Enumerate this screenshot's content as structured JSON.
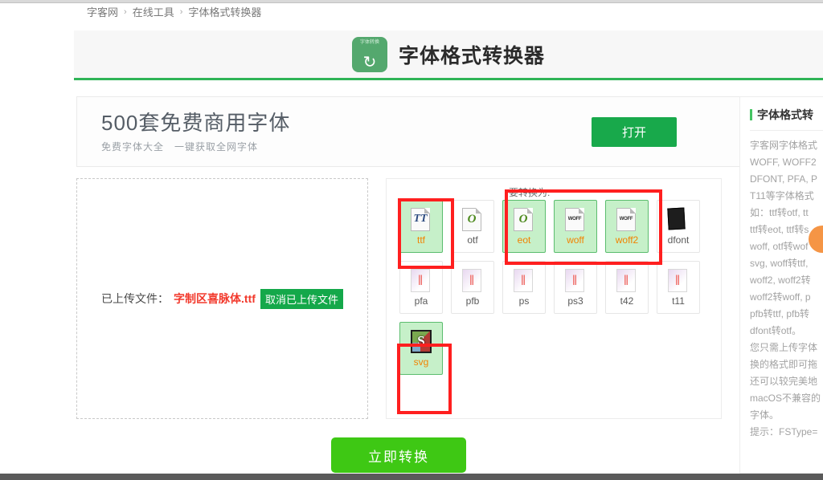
{
  "breadcrumb": {
    "items": [
      "字客网",
      "在线工具",
      "字体格式转换器"
    ],
    "separator": "›"
  },
  "header": {
    "logo_mini_text": "字体转换",
    "logo_glyph": "↻",
    "title": "字体格式转换器"
  },
  "ad_banner": {
    "title": "500套免费商用字体",
    "subtitle": "免费字体大全　一键获取全网字体",
    "button_label": "打开",
    "button_color": "#18a94b"
  },
  "upload": {
    "label": "已上传文件：",
    "filename": "字制区喜脉体.ttf",
    "filename_color": "#f2392c",
    "cancel_label": "取消已上传文件",
    "cancel_color": "#14a84a"
  },
  "formats": {
    "convert_to_label": "要转换为:",
    "selected_bg": "#c6f0c9",
    "selected_border": "#5bbd6e",
    "selected_label_color": "#f28200",
    "items": [
      {
        "name": "ttf",
        "icon": "truetype-file-icon",
        "selected": true
      },
      {
        "name": "otf",
        "icon": "opentype-file-icon",
        "selected": false
      },
      {
        "name": "eot",
        "icon": "opentype-file-icon",
        "selected": true
      },
      {
        "name": "woff",
        "icon": "woff-file-icon",
        "selected": true
      },
      {
        "name": "woff2",
        "icon": "woff-file-icon",
        "selected": true
      },
      {
        "name": "dfont",
        "icon": "dfont-file-icon",
        "selected": false
      },
      {
        "name": "pfa",
        "icon": "postscript-file-icon",
        "selected": false
      },
      {
        "name": "pfb",
        "icon": "postscript-file-icon",
        "selected": false
      },
      {
        "name": "ps",
        "icon": "postscript-file-icon",
        "selected": false
      },
      {
        "name": "ps3",
        "icon": "postscript-file-icon",
        "selected": false
      },
      {
        "name": "t42",
        "icon": "postscript-file-icon",
        "selected": false
      },
      {
        "name": "t11",
        "icon": "postscript-file-icon",
        "selected": false
      },
      {
        "name": "svg",
        "icon": "svg-file-icon",
        "selected": true
      }
    ]
  },
  "annotations": {
    "color": "#ff1f1f",
    "boxes": [
      "source-format-ttf",
      "web-formats-eot-woff-woff2",
      "svg-format"
    ]
  },
  "convert_button": {
    "label": "立即转换",
    "color": "#3ec814"
  },
  "sidebar": {
    "title": "字体格式转",
    "paragraphs": [
      "字客网字体格式",
      "WOFF, WOFF2",
      "DFONT, PFA, P",
      "T11等字体格式",
      "如：ttf转otf, tt",
      "ttf转eot, ttf转s",
      "woff, otf转wof",
      "svg, woff转ttf,",
      "woff2, woff2转",
      "woff2转woff, p",
      "pfb转ttf, pfb转",
      "dfont转otf。",
      "您只需上传字体",
      "换的格式即可拖",
      "还可以较完美地",
      "macOS不兼容的",
      "字体。",
      "提示：FSType="
    ]
  },
  "floating_action": {
    "name": "floating-action-button",
    "color": "#f59545"
  }
}
